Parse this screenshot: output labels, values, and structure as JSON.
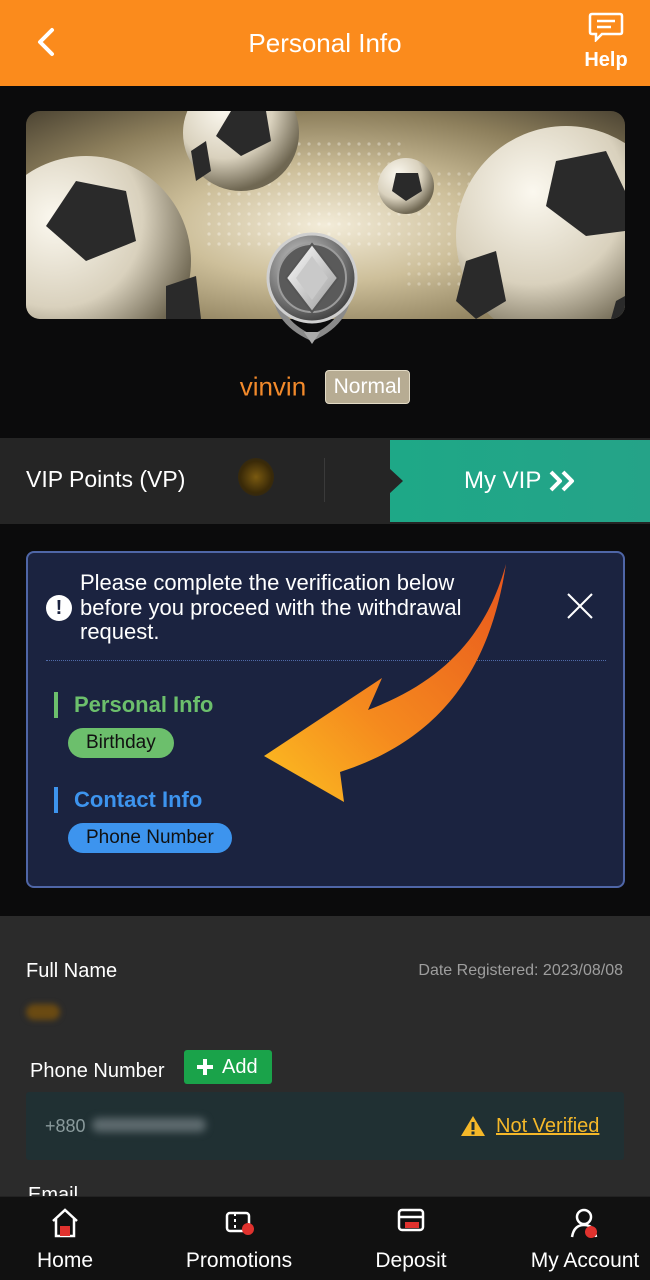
{
  "header": {
    "title": "Personal Info",
    "help_label": "Help"
  },
  "profile": {
    "username": "vinvin",
    "tier": "Normal"
  },
  "vip": {
    "label": "VIP Points (VP)",
    "button_label": "My VIP"
  },
  "verification": {
    "message": "Please complete the verification below before you proceed with the withdrawal request.",
    "sections": [
      {
        "title": "Personal Info",
        "chip": "Birthday",
        "color": "#6cbf6c"
      },
      {
        "title": "Contact Info",
        "chip": "Phone Number",
        "color": "#3d94ee"
      }
    ]
  },
  "form": {
    "full_name_label": "Full Name",
    "date_registered": "Date Registered: 2023/08/08",
    "phone_label": "Phone Number",
    "add_label": "Add",
    "phone_prefix": "+880",
    "status": "Not Verified",
    "email_label": "Email"
  },
  "nav": {
    "items": [
      {
        "label": "Home",
        "icon": "home-icon"
      },
      {
        "label": "Promotions",
        "icon": "promotions-icon"
      },
      {
        "label": "Deposit",
        "icon": "deposit-icon",
        "active": true
      },
      {
        "label": "My Account",
        "icon": "account-icon"
      }
    ]
  },
  "colors": {
    "header": "#fb8b1c",
    "accent_teal": "#1ea887",
    "username": "#f38a2b",
    "warning": "#f5b829"
  }
}
